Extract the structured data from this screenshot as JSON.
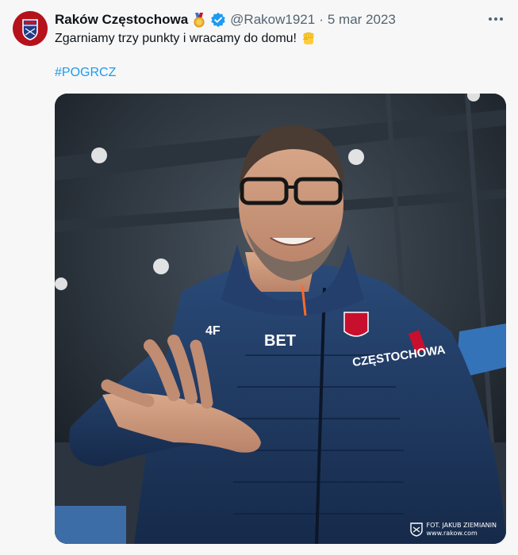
{
  "tweet": {
    "display_name": "Raków Częstochowa",
    "handle": "@Rakow1921",
    "separator": "·",
    "date": "5 mar 2023",
    "text": "Zgarniamy trzy punkty i wracamy do domu!",
    "hashtag": "#POGRCZ"
  },
  "icons": {
    "avatar": "rakow-crest-icon",
    "medal": "medal-icon",
    "verified": "verified-badge-icon",
    "more": "more-horizontal-icon",
    "fist": "raised-fist-emoji-icon"
  },
  "media": {
    "jacket_text_sponsor": "BET",
    "jacket_text_club": "CZĘSTOCHOWA",
    "jacket_text_brand": "4F",
    "watermark_line1": "FOT. JAKUB ZIEMIANIN",
    "watermark_line2": "www.rakow.com"
  },
  "colors": {
    "accent": "#1d9bf0",
    "secondary_text": "#536471",
    "club_red": "#c8102e",
    "club_blue": "#1b3a6b"
  }
}
